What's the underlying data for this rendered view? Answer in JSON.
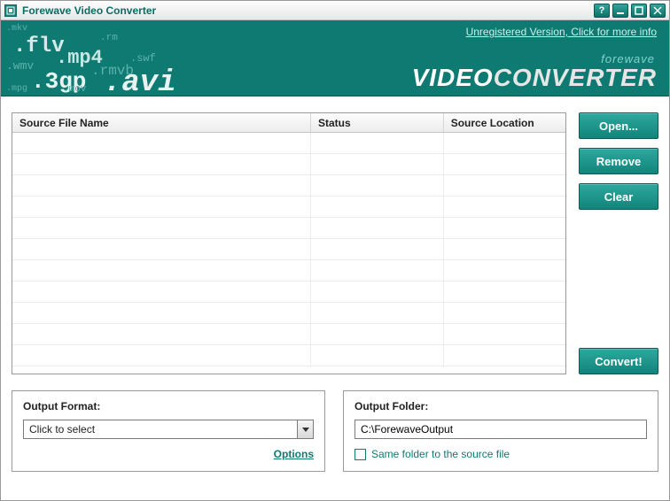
{
  "titlebar": {
    "title": "Forewave Video Converter"
  },
  "banner": {
    "unregistered_link": "Unregistered Version, Click for more info",
    "brand_small": "forewave",
    "brand_big_1": "VIDEO",
    "brand_big_2": "CONVERTER",
    "formats": [
      ".mkv",
      ".flv",
      ".rm",
      ".wmv",
      ".mp4",
      ".swf",
      ".3gp",
      ".rmvb",
      ".mpg",
      ".mov",
      ".avi"
    ]
  },
  "table": {
    "headers": {
      "name": "Source File Name",
      "status": "Status",
      "location": "Source Location"
    }
  },
  "buttons": {
    "open": "Open...",
    "remove": "Remove",
    "clear": "Clear",
    "convert": "Convert!"
  },
  "output_format": {
    "label": "Output Format:",
    "selected": "Click to select",
    "options_link": "Options"
  },
  "output_folder": {
    "label": "Output Folder:",
    "value": "C:\\ForewaveOutput",
    "same_folder_label": "Same folder to the source file"
  }
}
